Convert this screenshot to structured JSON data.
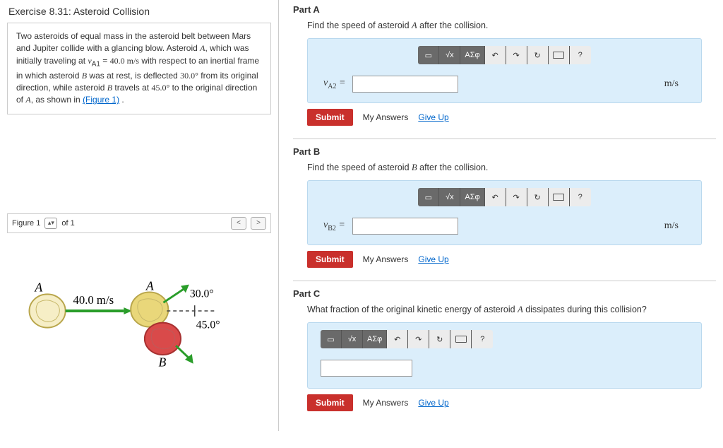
{
  "exercise": {
    "title": "Exercise 8.31: Asteroid Collision",
    "statement_html": "Two asteroids of equal mass in the asteroid belt between Mars and Jupiter collide with a glancing blow. Asteroid A, which was initially traveling at vA1 = 40.0 m/s with respect to an inertial frame in which asteroid B was at rest, is deflected 30.0° from its original direction, while asteroid B travels at 45.0° to the original direction of A, as shown in",
    "figure_link_text": "(Figure 1)"
  },
  "figure_bar": {
    "label": "Figure 1",
    "of": "of 1"
  },
  "figure": {
    "label_A": "A",
    "label_B": "B",
    "velocity": "40.0 m/s",
    "angle_a": "30.0°",
    "angle_b": "45.0°"
  },
  "toolbar": {
    "sqrt": "√x",
    "greek": "ΑΣφ",
    "undo": "↶",
    "redo": "↷",
    "reset": "↻",
    "help": "?"
  },
  "parts": {
    "a": {
      "title": "Part A",
      "prompt": "Find the speed of asteroid A after the collision.",
      "lhs": "vA2 =",
      "unit": "m/s"
    },
    "b": {
      "title": "Part B",
      "prompt": "Find the speed of asteroid B after the collision.",
      "lhs": "vB2 =",
      "unit": "m/s"
    },
    "c": {
      "title": "Part C",
      "prompt": "What fraction of the original kinetic energy of asteroid A dissipates during this collision?"
    }
  },
  "actions": {
    "submit": "Submit",
    "my_answers": "My Answers",
    "give_up": "Give Up"
  }
}
